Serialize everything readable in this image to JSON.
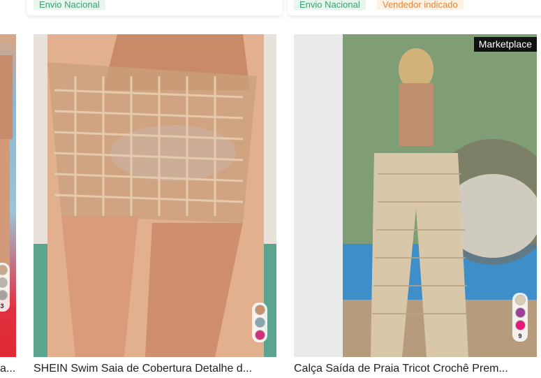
{
  "top_cards": [
    {
      "tags": [
        {
          "text": "Envio Nacional",
          "color": "#3aa36b"
        }
      ]
    },
    {
      "tags": [
        {
          "text": "Envio Nacional",
          "color": "#3aa36b"
        },
        {
          "text": "Vendedor indicado",
          "color": "#e2883a"
        }
      ]
    }
  ],
  "products": [
    {
      "title": "a...",
      "swatch_colors": [
        "#c9a98e",
        "#b9b4ad",
        "#a7a29c"
      ],
      "swatch_count": "3"
    },
    {
      "title": "SHEIN Swim Saia de Cobertura Detalhe d...",
      "swatch_colors": [
        "#c9906a",
        "#86a5ae",
        "#d0317a"
      ]
    },
    {
      "title": "Calça Saída de Praia Tricot Crochê Prem...",
      "badge": "Marketplace",
      "swatch_colors": [
        "#d9ceb5",
        "#9b3f9a",
        "#e6187a"
      ],
      "swatch_count": "9"
    }
  ]
}
